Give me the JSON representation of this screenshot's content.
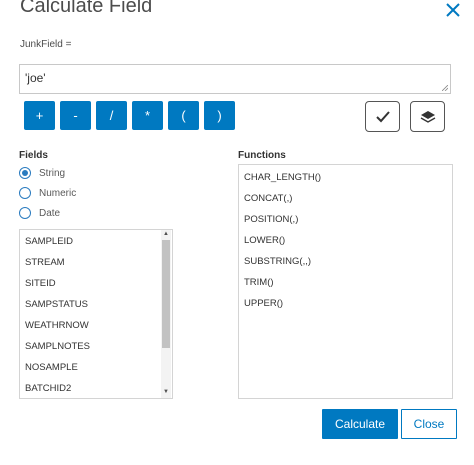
{
  "dialog": {
    "title": "Calculate Field",
    "field_label": "JunkField =",
    "expression": "'joe'"
  },
  "operators": [
    "+",
    "-",
    "/",
    "*",
    "(",
    ")"
  ],
  "icons": {
    "close": "close-icon",
    "validate": "checkmark-icon",
    "help": "layers-icon"
  },
  "fields": {
    "heading": "Fields",
    "type_options": [
      {
        "label": "String",
        "selected": true
      },
      {
        "label": "Numeric",
        "selected": false
      },
      {
        "label": "Date",
        "selected": false
      }
    ],
    "items": [
      "SAMPLEID",
      "STREAM",
      "SITEID",
      "SAMPSTATUS",
      "WEATHRNOW",
      "SAMPLNOTES",
      "NOSAMPLE",
      "BATCHID2"
    ]
  },
  "functions": {
    "heading": "Functions",
    "items": [
      "CHAR_LENGTH()",
      "CONCAT(,)",
      "POSITION(,)",
      "LOWER()",
      "SUBSTRING(,,)",
      "TRIM()",
      "UPPER()"
    ]
  },
  "footer": {
    "calculate_label": "Calculate",
    "close_label": "Close"
  },
  "colors": {
    "accent": "#0079c1",
    "text": "#4c4c4c"
  }
}
